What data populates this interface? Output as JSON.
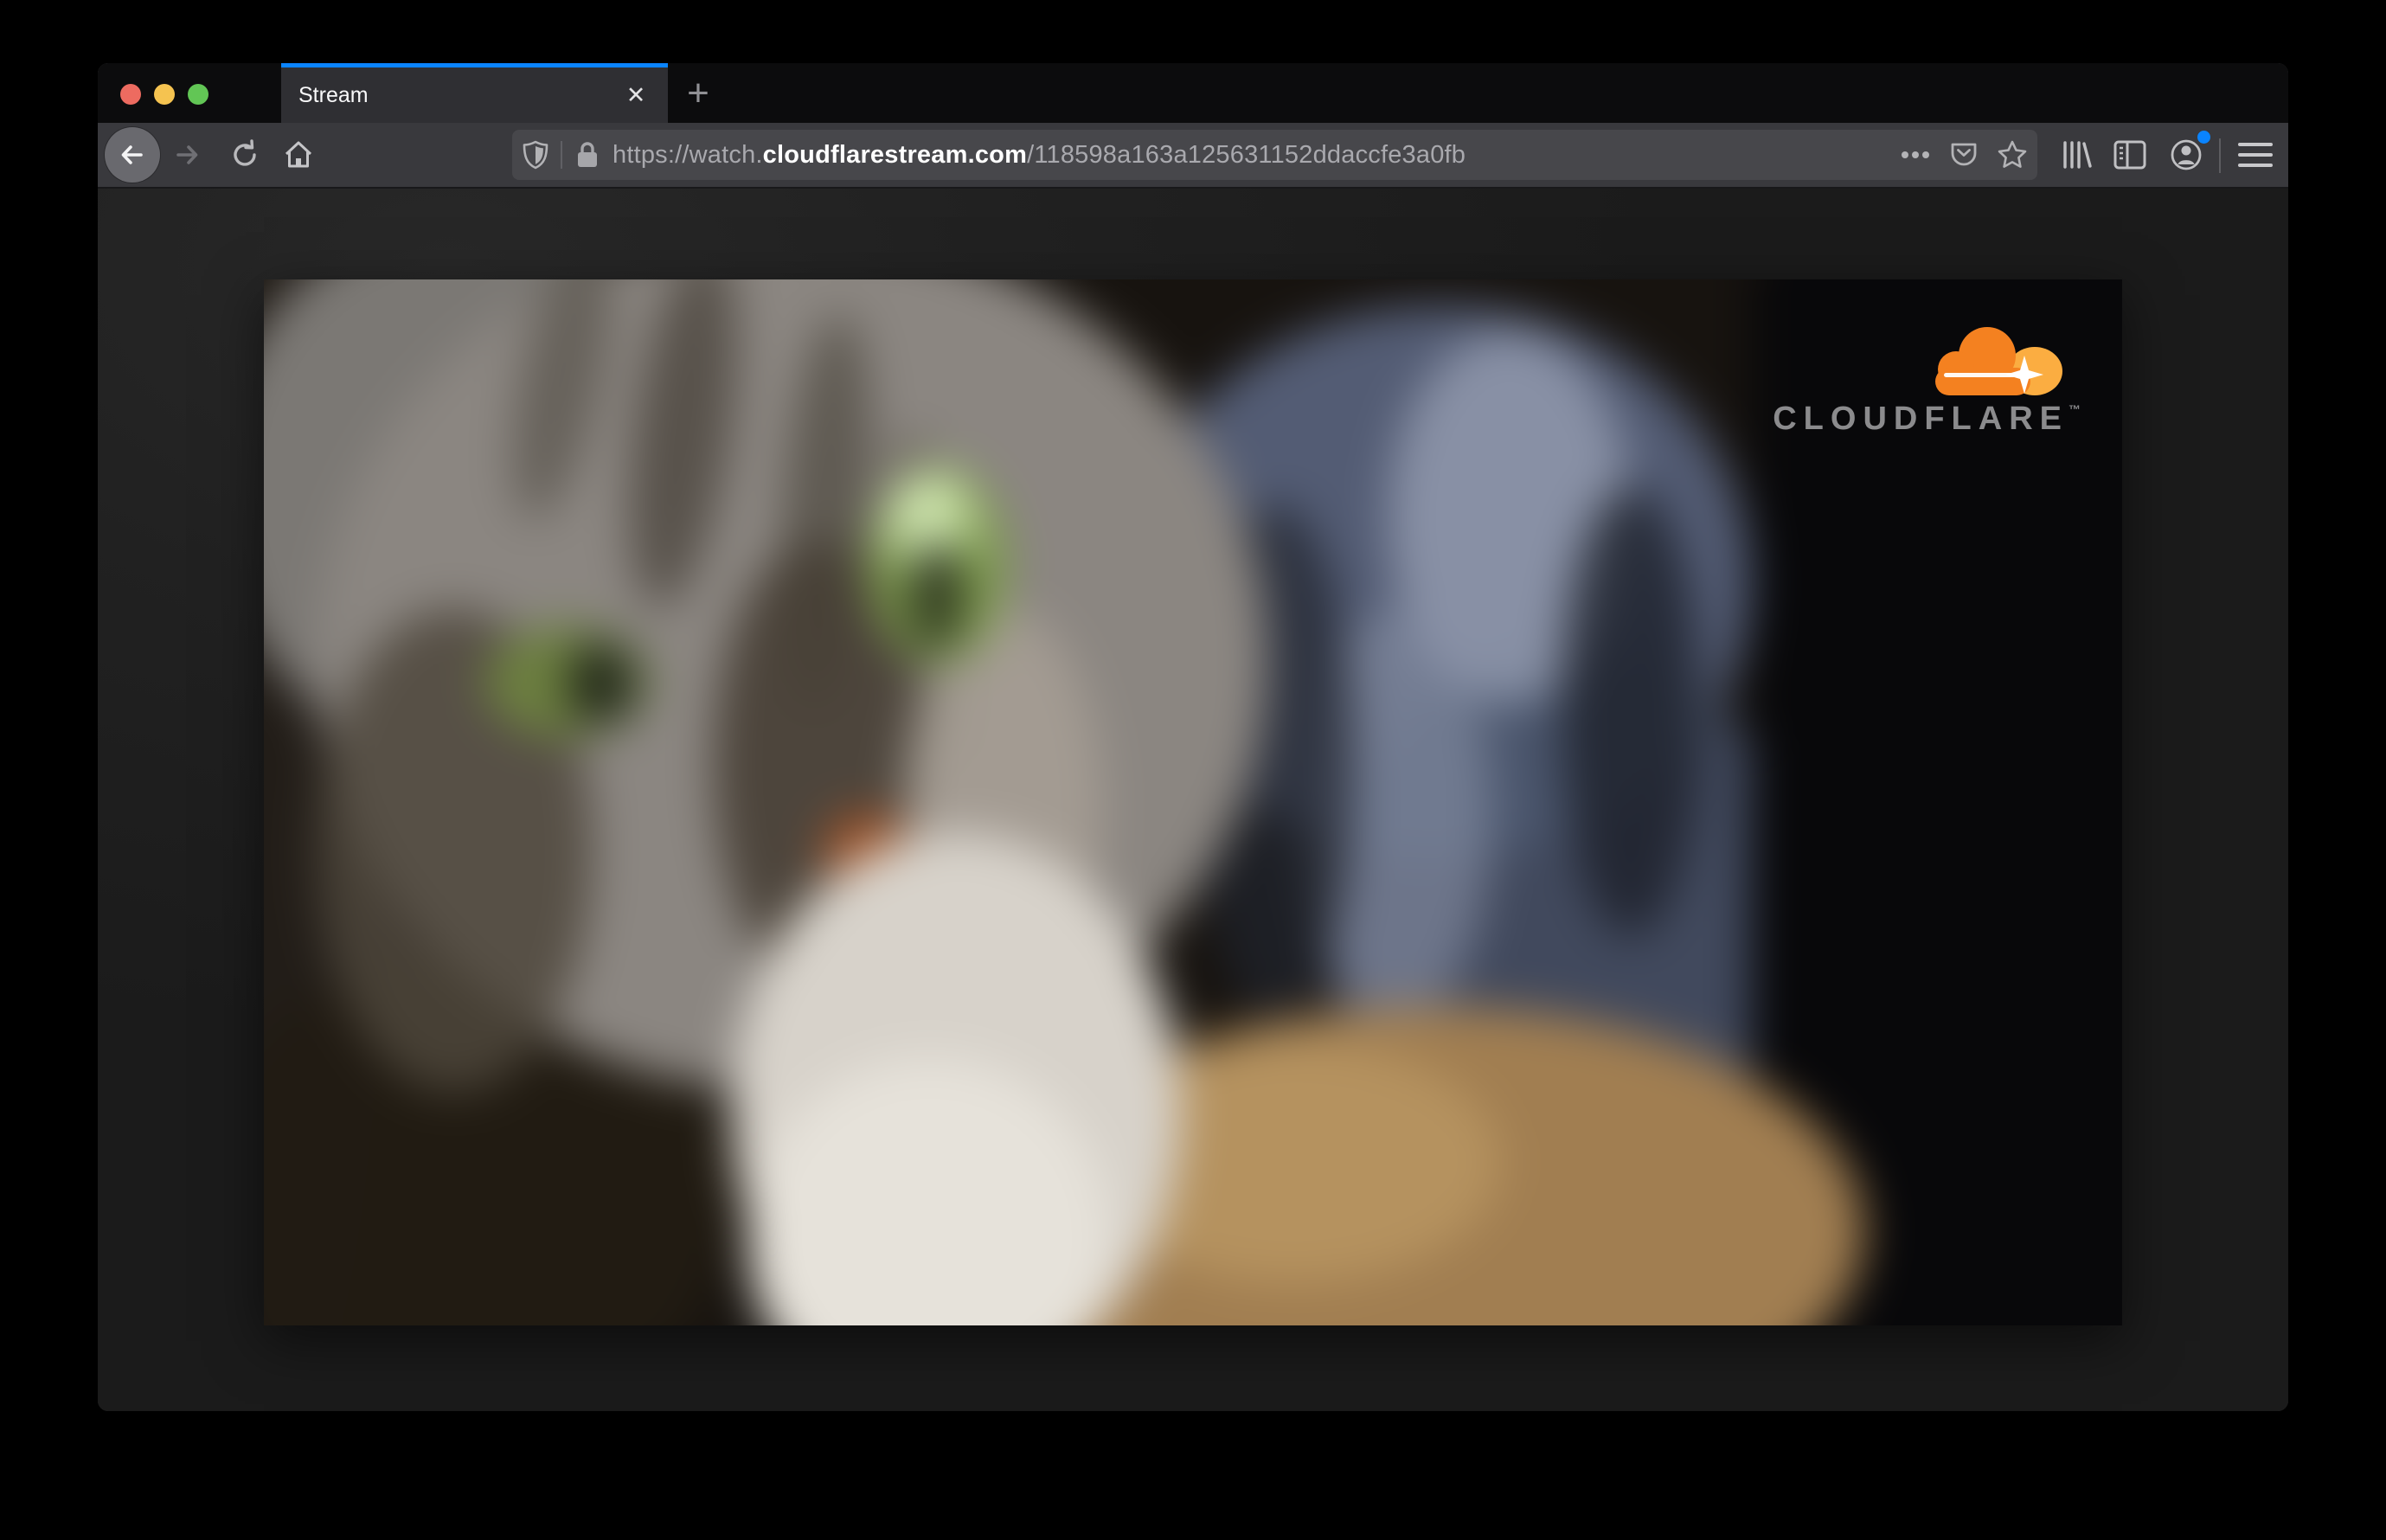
{
  "browser": {
    "traffic_lights": {
      "close_color": "#ed6b60",
      "minimize_color": "#f5c350",
      "zoom_color": "#62c655"
    },
    "tab_bar": {
      "active_tab_title": "Stream",
      "active_tab_accent": "#0a84ff",
      "close_glyph": "✕",
      "new_tab_glyph": "+"
    },
    "toolbar": {
      "address_bar": {
        "url_prefix": "https://watch.",
        "url_domain": "cloudflarestream.com",
        "url_path": "/118598a163a125631152ddaccfe3a0fb"
      },
      "account_badge_color": "#0a84ff"
    }
  },
  "video": {
    "logo": {
      "wordmark": "CLOUDFLARE",
      "trademark": "™",
      "cloud_primary": "#f48120",
      "cloud_secondary": "#fbad41",
      "wordmark_color": "#8b8b8d"
    }
  }
}
